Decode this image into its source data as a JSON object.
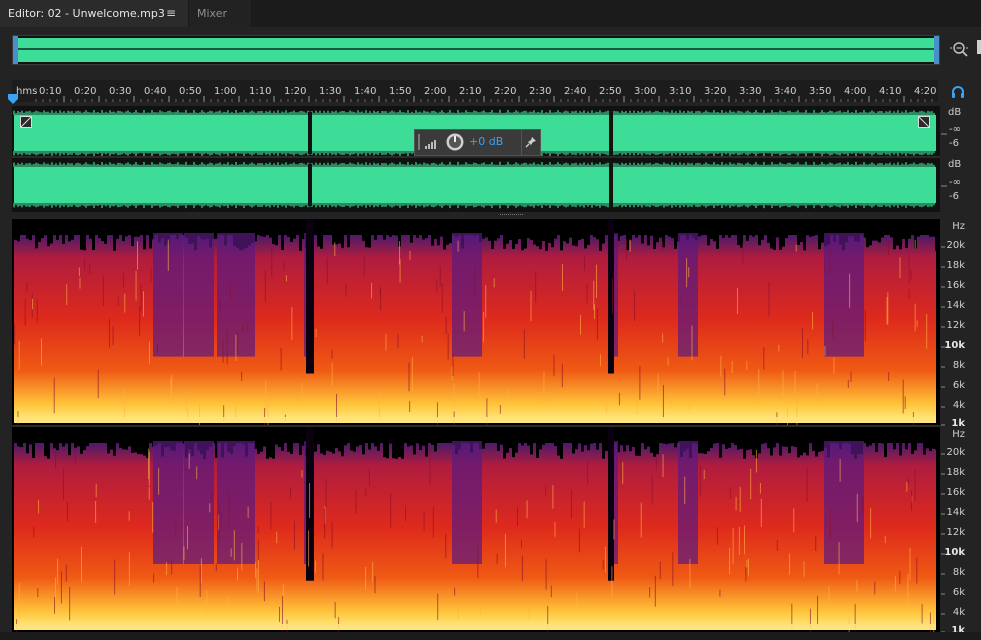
{
  "tabs": {
    "editor_label": "Editor: 02 - Unwelcome.mp3",
    "menu_glyph": "≡",
    "mixer_label": "Mixer"
  },
  "ruler": {
    "unit_label": "hms",
    "ticks": [
      "0:10",
      "0:20",
      "0:30",
      "0:40",
      "0:50",
      "1:00",
      "1:10",
      "1:20",
      "1:30",
      "1:40",
      "1:50",
      "2:00",
      "2:10",
      "2:20",
      "2:30",
      "2:40",
      "2:50",
      "3:00",
      "3:10",
      "3:20",
      "3:30",
      "3:40",
      "3:50",
      "4:00",
      "4:10",
      "4:20"
    ]
  },
  "hud": {
    "gain_label": "+0 dB"
  },
  "wave_scale": {
    "channel1": [
      "dB",
      "-∞",
      "-6"
    ],
    "channel2": [
      "dB",
      "-∞",
      "-6"
    ]
  },
  "spectral_scale": {
    "unit": "Hz",
    "labels": [
      "20k",
      "18k",
      "16k",
      "14k",
      "12k",
      "10k",
      "8k",
      "6k",
      "4k",
      "1k"
    ],
    "bold_labels": [
      "10k",
      "1k"
    ]
  },
  "colors": {
    "waveform": "#3ddc97",
    "accent": "#3aa3f4",
    "spectrum_low": "#ffd23a",
    "spectrum_mid": "#e3361a",
    "spectrum_high": "#5a1a80"
  },
  "icons": {
    "zoom": "zoom-icon",
    "headphone": "headphone-icon",
    "pin": "pin-icon",
    "knob": "knob-icon",
    "meter": "level-meter-icon",
    "fade_in": "fade-in-handle-icon",
    "fade_out": "fade-out-handle-icon"
  }
}
